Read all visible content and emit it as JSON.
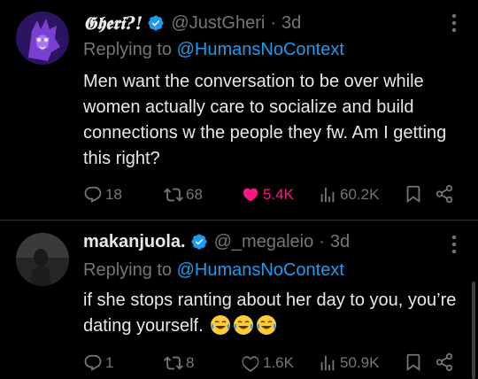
{
  "tweets": [
    {
      "display_name": "𝕲𝖍𝖊𝖗𝖎?!",
      "handle": "@JustGheri",
      "time": "3d",
      "replying_prefix": "Replying to ",
      "replying_to": "@HumansNoContext",
      "text": "Men want the conversation to be over while women actually care to socialize and build connections w the people they fw. Am I getting this right?",
      "stats": {
        "replies": "18",
        "reposts": "68",
        "likes": "5.4K",
        "views": "60.2K"
      },
      "liked": true,
      "avatar_colors": [
        "#6a2fb5",
        "#1a0b33"
      ]
    },
    {
      "display_name": "makanjuola.",
      "handle": "@_megaleio",
      "time": "3d",
      "replying_prefix": "Replying to ",
      "replying_to": "@HumansNoContext",
      "text": "if she stops ranting about her day to you, you’re dating yourself.",
      "emojis": [
        "face-with-tears-of-joy",
        "face-with-tears-of-joy",
        "face-with-tears-of-joy"
      ],
      "stats": {
        "replies": "1",
        "reposts": "8",
        "likes": "1.6K",
        "views": "50.9K"
      },
      "liked": false,
      "avatar_colors": [
        "#3a3a3a",
        "#121212"
      ]
    }
  ],
  "colors": {
    "accent": "#1d9bf0",
    "like": "#f91880",
    "muted": "#71767b",
    "text": "#e7e9ea",
    "background": "#000000",
    "divider": "#2f3336"
  }
}
